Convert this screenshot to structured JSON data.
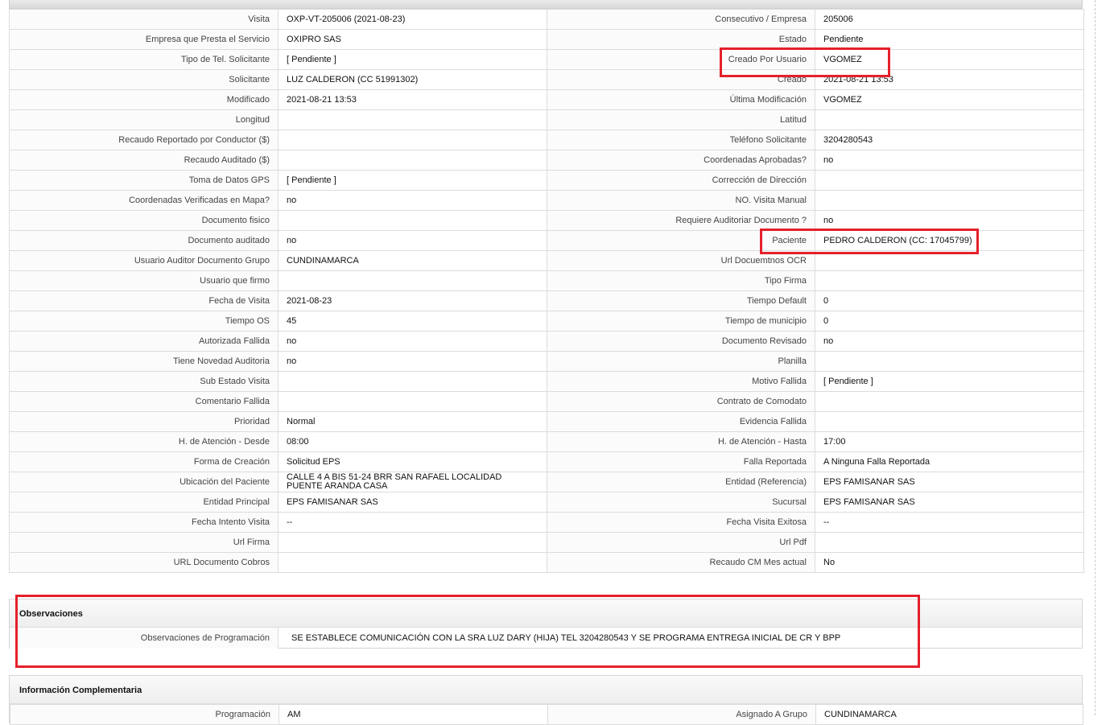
{
  "details": {
    "rows": [
      {
        "l1": "Visita",
        "v1": "OXP-VT-205006 (2021-08-23)",
        "l2": "Consecutivo / Empresa",
        "v2": "205006"
      },
      {
        "l1": "Empresa que Presta el Servicio",
        "v1": "OXIPRO SAS",
        "l2": "Estado",
        "v2": "Pendiente"
      },
      {
        "l1": "Tipo de Tel. Solicitante",
        "v1": "[ Pendiente ]",
        "l2": "Creado Por Usuario",
        "v2": "VGOMEZ"
      },
      {
        "l1": "Solicitante",
        "v1": "LUZ CALDERON (CC 51991302)",
        "l2": "Creado",
        "v2": "2021-08-21 13:53"
      },
      {
        "l1": "Modificado",
        "v1": "2021-08-21 13:53",
        "l2": "Última Modificación",
        "v2": " VGOMEZ"
      },
      {
        "l1": "Longitud",
        "v1": "",
        "l2": "Latitud",
        "v2": ""
      },
      {
        "l1": "Recaudo Reportado por Conductor ($)",
        "v1": "",
        "l2": "Teléfono Solicitante",
        "v2": "3204280543"
      },
      {
        "l1": "Recaudo Auditado ($)",
        "v1": "",
        "l2": "Coordenadas Aprobadas?",
        "v2": " no"
      },
      {
        "l1": "Toma de Datos GPS",
        "v1": "[ Pendiente ]",
        "l2": "Corrección de Dirección",
        "v2": ""
      },
      {
        "l1": "Coordenadas Verificadas en Mapa?",
        "v1": " no",
        "l2": "NO. Visita Manual",
        "v2": ""
      },
      {
        "l1": "Documento fisico",
        "v1": "",
        "l2": "Requiere Auditoriar Documento ?",
        "v2": " no"
      },
      {
        "l1": "Documento auditado",
        "v1": " no",
        "l2": "Paciente",
        "v2": "PEDRO CALDERON (CC: 17045799)"
      },
      {
        "l1": "Usuario Auditor Documento Grupo",
        "v1": "CUNDINAMARCA",
        "l2": "Url Docuemtnos OCR",
        "v2": ""
      },
      {
        "l1": "Usuario que firmo",
        "v1": "",
        "l2": "Tipo Firma",
        "v2": ""
      },
      {
        "l1": "Fecha de Visita",
        "v1": " 2021-08-23",
        "l2": "Tiempo Default",
        "v2": "0"
      },
      {
        "l1": "Tiempo OS",
        "v1": "45",
        "l2": "Tiempo de municipio",
        "v2": "0"
      },
      {
        "l1": "Autorizada Fallida",
        "v1": " no",
        "l2": "Documento Revisado",
        "v2": " no"
      },
      {
        "l1": "Tiene Novedad Auditoria",
        "v1": " no",
        "l2": "Planilla",
        "v2": ""
      },
      {
        "l1": "Sub Estado Visita",
        "v1": "",
        "l2": "Motivo Fallida",
        "v2": "[ Pendiente ]"
      },
      {
        "l1": "Comentario Fallida",
        "v1": "",
        "l2": "Contrato de Comodato",
        "v2": ""
      },
      {
        "l1": "Prioridad",
        "v1": "Normal",
        "l2": "Evidencia Fallida",
        "v2": ""
      },
      {
        "l1": "H. de Atención - Desde",
        "v1": "08:00",
        "l2": "H. de Atención - Hasta",
        "v2": "17:00"
      },
      {
        "l1": "Forma de Creación",
        "v1": "Solicitud EPS",
        "l2": "Falla Reportada",
        "v2": "A Ninguna Falla Reportada"
      },
      {
        "l1": "Ubicación del Paciente",
        "v1": "CALLE 4 A BIS 51-24 BRR SAN RAFAEL LOCALIDAD PUENTE ARANDA CASA",
        "l2": "Entidad (Referencia)",
        "v2": "EPS FAMISANAR SAS"
      },
      {
        "l1": "Entidad Principal",
        "v1": "EPS FAMISANAR SAS",
        "l2": "Sucursal",
        "v2": "EPS FAMISANAR SAS"
      },
      {
        "l1": "Fecha Intento Visita",
        "v1": " --",
        "l2": "Fecha Visita Exitosa",
        "v2": " --"
      },
      {
        "l1": "Url Firma",
        "v1": "",
        "l2": "Url Pdf",
        "v2": ""
      },
      {
        "l1": "URL Documento Cobros",
        "v1": "",
        "l2": "Recaudo CM Mes actual",
        "v2": "No"
      }
    ]
  },
  "observaciones": {
    "title": "Observaciones",
    "label": "Observaciones de Programación",
    "value": "SE ESTABLECE COMUNICACIÓN CON LA SRA LUZ DARY (HIJA) TEL 3204280543 Y SE PROGRAMA ENTREGA INICIAL DE CR Y BPP"
  },
  "info_complementaria": {
    "title": "Información Complementaria",
    "l1": "Programación",
    "v1": "AM",
    "l2": "Asignado A Grupo",
    "v2": "CUNDINAMARCA"
  },
  "colors": {
    "highlight": "#e5202a",
    "border": "#dcdcdc"
  }
}
